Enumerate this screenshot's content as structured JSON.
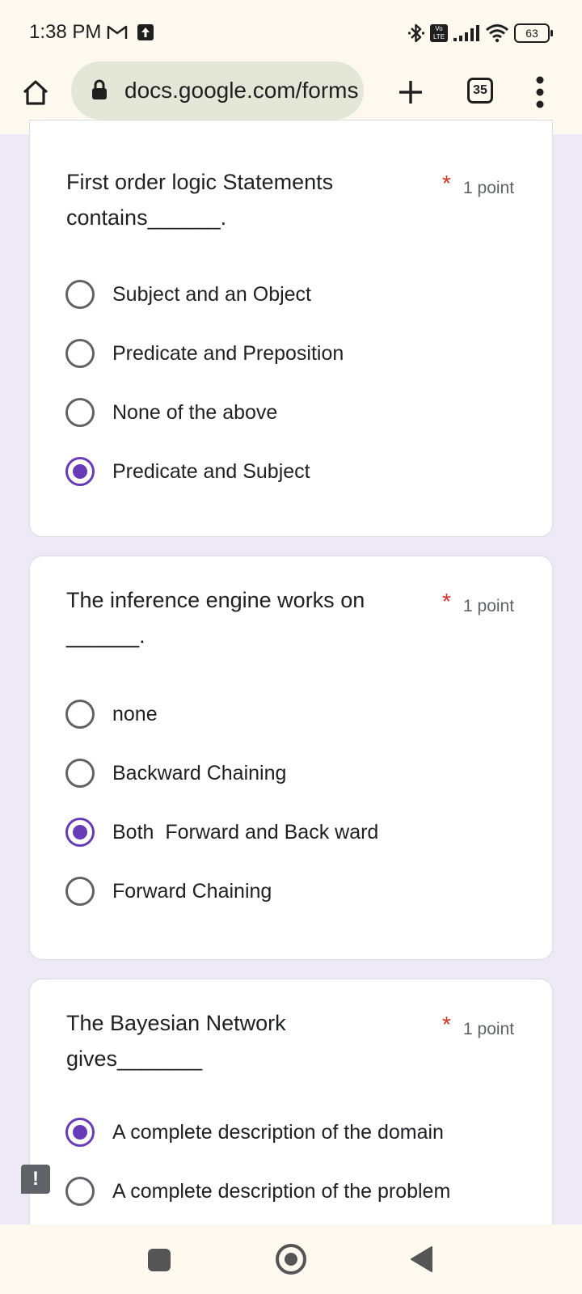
{
  "status_bar": {
    "time": "1:38 PM",
    "volte_top": "Vo",
    "volte_bottom": "LTE",
    "battery": "63"
  },
  "browser": {
    "url": "docs.google.com/forms",
    "tab_count": "35"
  },
  "questions": [
    {
      "title": "First order logic Statements contains______.",
      "required_mark": "*",
      "points": "1 point",
      "options": [
        {
          "label": "Subject and an Object",
          "selected": false
        },
        {
          "label": "Predicate and Preposition",
          "selected": false
        },
        {
          "label": "None of the above",
          "selected": false
        },
        {
          "label": "Predicate and Subject",
          "selected": true
        }
      ]
    },
    {
      "title": "The inference engine works on ______.",
      "required_mark": "*",
      "points": "1 point",
      "options": [
        {
          "label": "none",
          "selected": false
        },
        {
          "label": "Backward Chaining",
          "selected": false
        },
        {
          "label": "Both  Forward and Back ward",
          "selected": true
        },
        {
          "label": "Forward Chaining",
          "selected": false
        }
      ]
    },
    {
      "title": "The Bayesian Network gives_______",
      "required_mark": "*",
      "points": "1 point",
      "options": [
        {
          "label": "A complete description of the domain",
          "selected": true
        },
        {
          "label": "A complete description of the problem",
          "selected": false
        }
      ]
    }
  ],
  "feedback_icon": "!",
  "colors": {
    "accent": "#673ab7",
    "required": "#d93025",
    "page_background": "#ede9f7"
  }
}
